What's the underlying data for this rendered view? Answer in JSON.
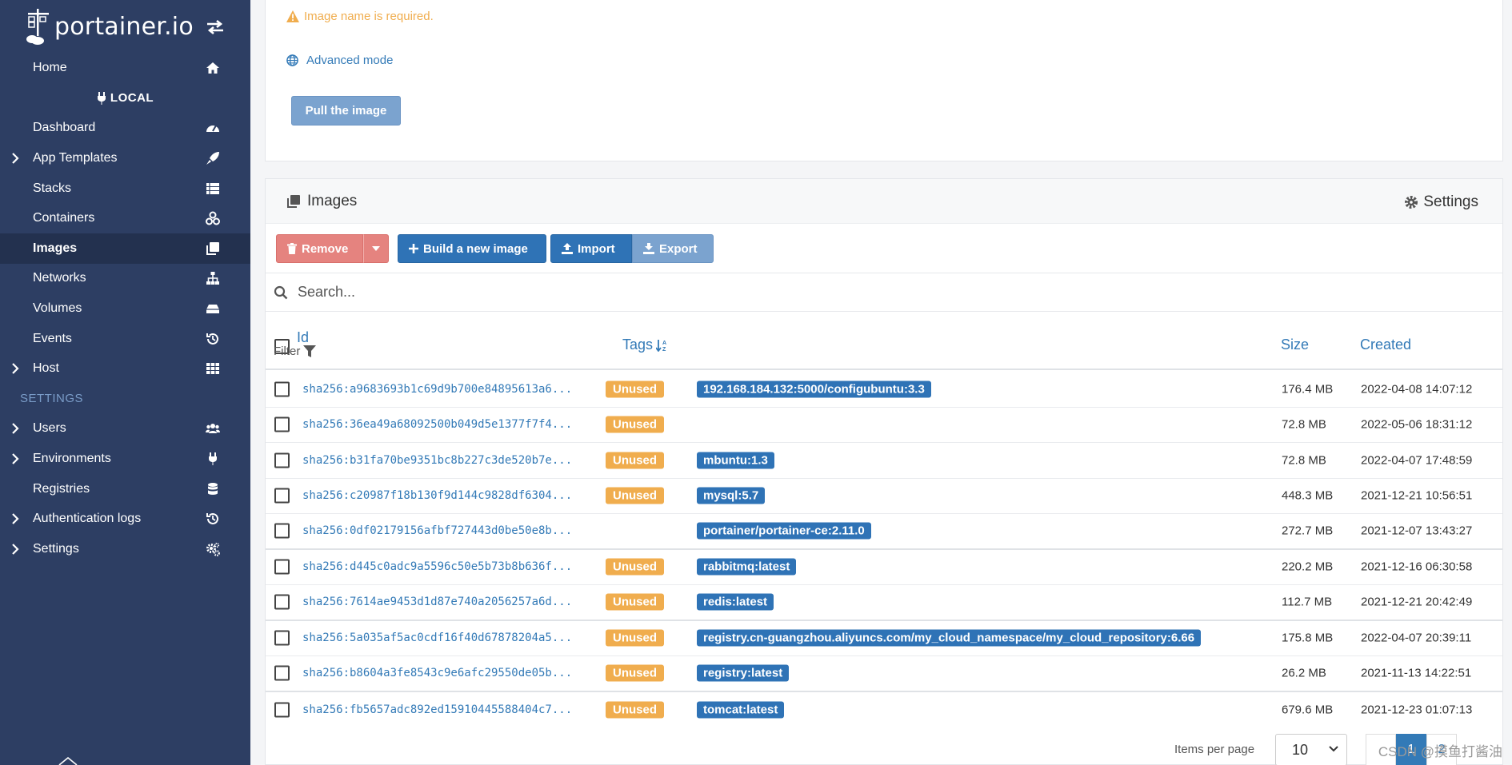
{
  "app": {
    "logo_text": "portainer.io"
  },
  "sidebar": {
    "home": "Home",
    "endpoint_label": "LOCAL",
    "items": [
      {
        "label": "Dashboard",
        "icon": "dashboard-icon"
      },
      {
        "label": "App Templates",
        "icon": "rocket-icon"
      },
      {
        "label": "Stacks",
        "icon": "stacks-icon"
      },
      {
        "label": "Containers",
        "icon": "containers-icon"
      },
      {
        "label": "Images",
        "icon": "images-icon"
      },
      {
        "label": "Networks",
        "icon": "network-icon"
      },
      {
        "label": "Volumes",
        "icon": "volume-icon"
      },
      {
        "label": "Events",
        "icon": "history-icon"
      },
      {
        "label": "Host",
        "icon": "grid-icon"
      }
    ],
    "settings_section": "SETTINGS",
    "settings_items": [
      {
        "label": "Users",
        "icon": "users-icon"
      },
      {
        "label": "Environments",
        "icon": "plug-icon"
      },
      {
        "label": "Registries",
        "icon": "database-icon"
      },
      {
        "label": "Authentication logs",
        "icon": "history-icon"
      },
      {
        "label": "Settings",
        "icon": "cogs-icon"
      }
    ]
  },
  "pull": {
    "warning": "Image name is required.",
    "advanced_mode": "Advanced mode",
    "pull_button": "Pull the image"
  },
  "images": {
    "title": "Images",
    "settings": "Settings",
    "actions": {
      "remove": "Remove",
      "build": "Build a new image",
      "import": "Import",
      "export": "Export"
    },
    "search_placeholder": "Search...",
    "columns": {
      "id": "Id",
      "filter": "Filter",
      "tags": "Tags",
      "size": "Size",
      "created": "Created"
    },
    "rows": [
      {
        "id": "sha256:a9683693b1c69d9b700e84895613a6...",
        "unused": "Unused",
        "tag": "192.168.184.132:5000/configubuntu:3.3",
        "size": "176.4 MB",
        "created": "2022-04-08 14:07:12"
      },
      {
        "id": "sha256:36ea49a68092500b049d5e1377f7f4...",
        "unused": "Unused",
        "tag": "",
        "size": "72.8 MB",
        "created": "2022-05-06 18:31:12"
      },
      {
        "id": "sha256:b31fa70be9351bc8b227c3de520b7e...",
        "unused": "Unused",
        "tag": "mbuntu:1.3",
        "size": "72.8 MB",
        "created": "2022-04-07 17:48:59"
      },
      {
        "id": "sha256:c20987f18b130f9d144c9828df6304...",
        "unused": "Unused",
        "tag": "mysql:5.7",
        "size": "448.3 MB",
        "created": "2021-12-21 10:56:51"
      },
      {
        "id": "sha256:0df02179156afbf727443d0be50e8b...",
        "unused": "",
        "tag": "portainer/portainer-ce:2.11.0",
        "size": "272.7 MB",
        "created": "2021-12-07 13:43:27"
      },
      {
        "id": "sha256:d445c0adc9a5596c50e5b73b8b636f...",
        "unused": "Unused",
        "tag": "rabbitmq:latest",
        "size": "220.2 MB",
        "created": "2021-12-16 06:30:58"
      },
      {
        "id": "sha256:7614ae9453d1d87e740a2056257a6d...",
        "unused": "Unused",
        "tag": "redis:latest",
        "size": "112.7 MB",
        "created": "2021-12-21 20:42:49"
      },
      {
        "id": "sha256:5a035af5ac0cdf16f40d67878204a5...",
        "unused": "Unused",
        "tag": "registry.cn-guangzhou.aliyuncs.com/my_cloud_namespace/my_cloud_repository:6.66",
        "size": "175.8 MB",
        "created": "2022-04-07 20:39:11"
      },
      {
        "id": "sha256:b8604a3fe8543c9e6afc29550de05b...",
        "unused": "Unused",
        "tag": "registry:latest",
        "size": "26.2 MB",
        "created": "2021-11-13 14:22:51"
      },
      {
        "id": "sha256:fb5657adc892ed15910445588404c7...",
        "unused": "Unused",
        "tag": "tomcat:latest",
        "size": "679.6 MB",
        "created": "2021-12-23 01:07:13"
      }
    ],
    "footer": {
      "items_per_page_label": "Items per page",
      "items_per_page": "10",
      "pages": [
        "1",
        "2"
      ]
    }
  },
  "watermark": "CSDN @摸鱼打酱油"
}
